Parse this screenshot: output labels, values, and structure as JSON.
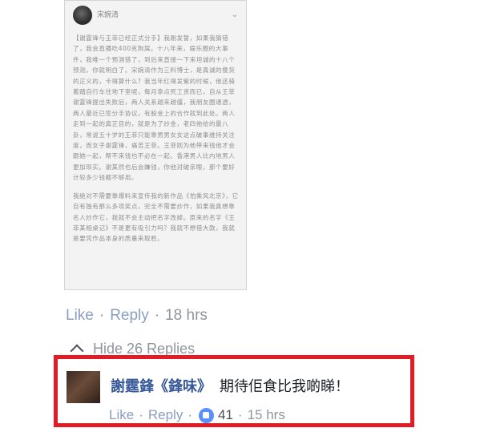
{
  "post_image": {
    "author": "宋婉清",
    "paragraphs": [
      "【谢霆锋与王菲已经正式分手】我刚发誓，如果我猜错了，我会直播吃400克狗屎。十八年来，娱乐圈的大事件，我唯一个预测错了，到后来直接一下来坦诚的十八个预测，你就明白了。宋婉清作为三料博士，是真诚的傻货的正义的，卡得算什么？我当年红得发紫的时候，他还骑着踏自行车往地下室呢，每月拿点死工资而已，自从王菲谢霆锋提出失败后，两人关系越来越僵，我朋友圈通透，两人最近已签分手协议，有股金上的合作就到此处。两人走到一起的真正目的，就是为了炒金，老四他给的最八卦，常说五十岁的王菲只能靠男男女女这点破事维持关注度，而女子谢霆锋，痛苦王菲。王菲则为他带来钱他才会跟她一起，帮不来钱也不必在一起。香港男人比内地男人更加现实。谢某然也后会嫌钱，你他对破亲眼，那个要好计较多少钱都不够用。",
      "我绝对不需要靠爆料来宣传我的新作品《怕乘风北京》，它自有独有那么多项奖点，完全不需要炒作，如果我真想靠名人炒作它，我就不会主动把名字改掉。原来的名字《王菲某相桌记》不是更有吸引力吗？我就不想借大款，我就是要凭作品本身的质量来取胜。"
    ]
  },
  "top_actions": {
    "like": "Like",
    "reply": "Reply",
    "separator": "·",
    "time": "18 hrs"
  },
  "hide_replies": {
    "label": "Hide 26 Replies"
  },
  "comment": {
    "author": "謝霆鋒《鋒味》",
    "text": "期待佢食比我啲睇！",
    "like": "Like",
    "reply": "Reply",
    "separator": "·",
    "like_count": "41",
    "time": "15 hrs"
  },
  "colors": {
    "highlight_border": "#e21c24",
    "author_link": "#365899",
    "like_badge": "#5890ff",
    "meta_gray": "#90949c"
  },
  "icons": {
    "hide_replies": "chevron-up-icon",
    "like_badge": "thumbs-up-icon",
    "post_menu": "chevron-down-icon"
  }
}
